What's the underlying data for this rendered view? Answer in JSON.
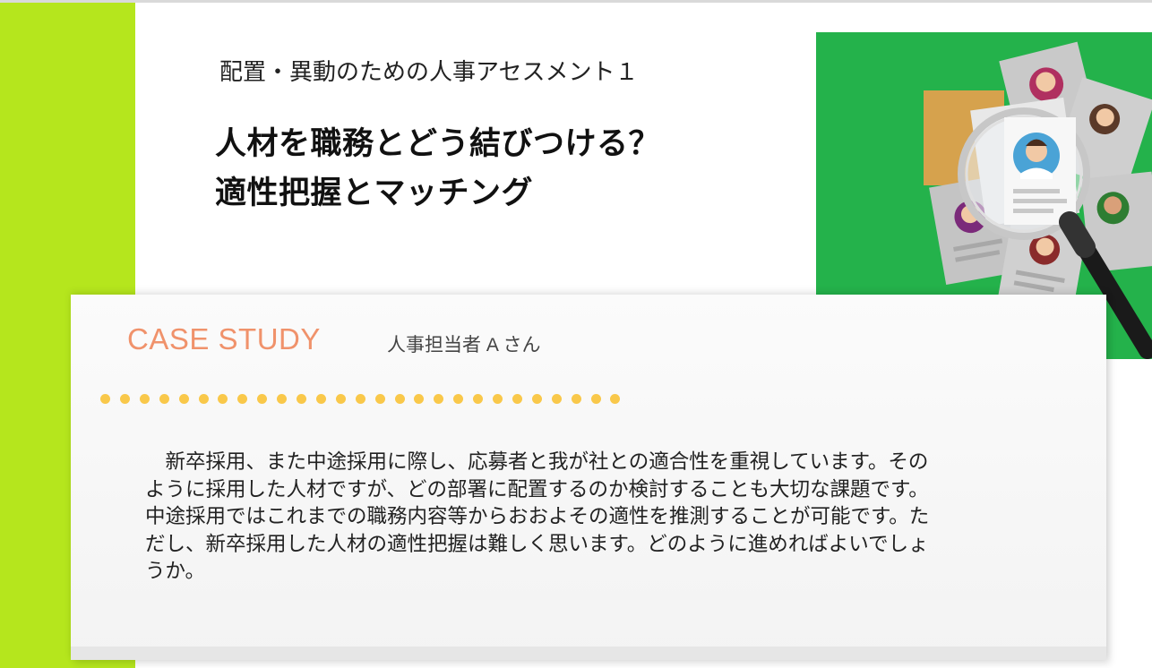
{
  "header": {
    "subtitle": "配置・異動のための人事アセスメント１",
    "title_line1": "人材を職務とどう結びつける？",
    "title_line2": "適性把握とマッチング"
  },
  "case": {
    "heading": "CASE STUDY",
    "person": "人事担当者 A さん",
    "body_lines": [
      "　新卒採用、また中途採用に際し、応募者と我が社との適合性を重視しています。その",
      "ように採用した人材ですが、どの部署に配置するのか検討することも大切な課題です。",
      "中途採用ではこれまでの職務内容等からおおよその適性を推測することが可能です。た",
      "だし、新卒採用した人材の適性把握は難しく思います。どのように進めればよいでしょ",
      "うか。"
    ]
  },
  "colors": {
    "accent_green": "#b5e61d",
    "image_green": "#24b24b",
    "case_orange": "#f0926b",
    "dot_yellow": "#f9c84a"
  },
  "icons": [
    "resume-magnifier-illustration"
  ]
}
